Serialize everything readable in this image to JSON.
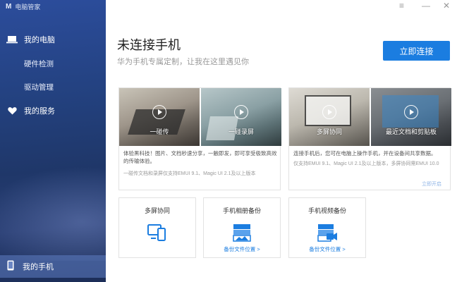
{
  "app": {
    "logo": "M",
    "title": "电脑管家"
  },
  "window_controls": {
    "menu": "≡",
    "minimize": "—",
    "close": "✕"
  },
  "sidebar": {
    "items": [
      {
        "label": "我的电脑",
        "icon": "laptop-icon"
      },
      {
        "label": "硬件检测"
      },
      {
        "label": "驱动管理"
      },
      {
        "label": "我的服务",
        "icon": "heart-icon"
      }
    ],
    "bottom": {
      "label": "我的手机",
      "icon": "phone-icon"
    }
  },
  "header": {
    "title": "未连接手机",
    "subtitle": "华为手机专属定制，让我在这里遇见你",
    "connect_button": "立即连接"
  },
  "feature_left": {
    "videos": [
      {
        "label": "一碰传"
      },
      {
        "label": "一碰录屏"
      }
    ],
    "description": "体验黑科技！图片、文档秒速分享，一触即发，即可享受极致高效的传输体验。",
    "note": "一碰传文档和录屏仅支持EMUI 9.1、Magic UI 2.1及以上版本"
  },
  "feature_right": {
    "videos": [
      {
        "label": "多屏协同"
      },
      {
        "label": "最近文档和剪贴板"
      }
    ],
    "description": "连接手机后，您可在电脑上操作手机，并在设备间共享数据。",
    "note": "仅支持EMUI 9.1、Magic UI 2.1及以上版本，多屏协同需EMUI 10.0",
    "link": "立即开启"
  },
  "cards": [
    {
      "title": "多屏协同",
      "icon": "multi-screen-icon",
      "link": ""
    },
    {
      "title": "手机相册备份",
      "icon": "photo-backup-icon",
      "link": "备份文件位置 >"
    },
    {
      "title": "手机视频备份",
      "icon": "video-backup-icon",
      "link": "备份文件位置 >"
    }
  ],
  "colors": {
    "accent": "#1b7de0",
    "sidebar": "#23417f"
  }
}
